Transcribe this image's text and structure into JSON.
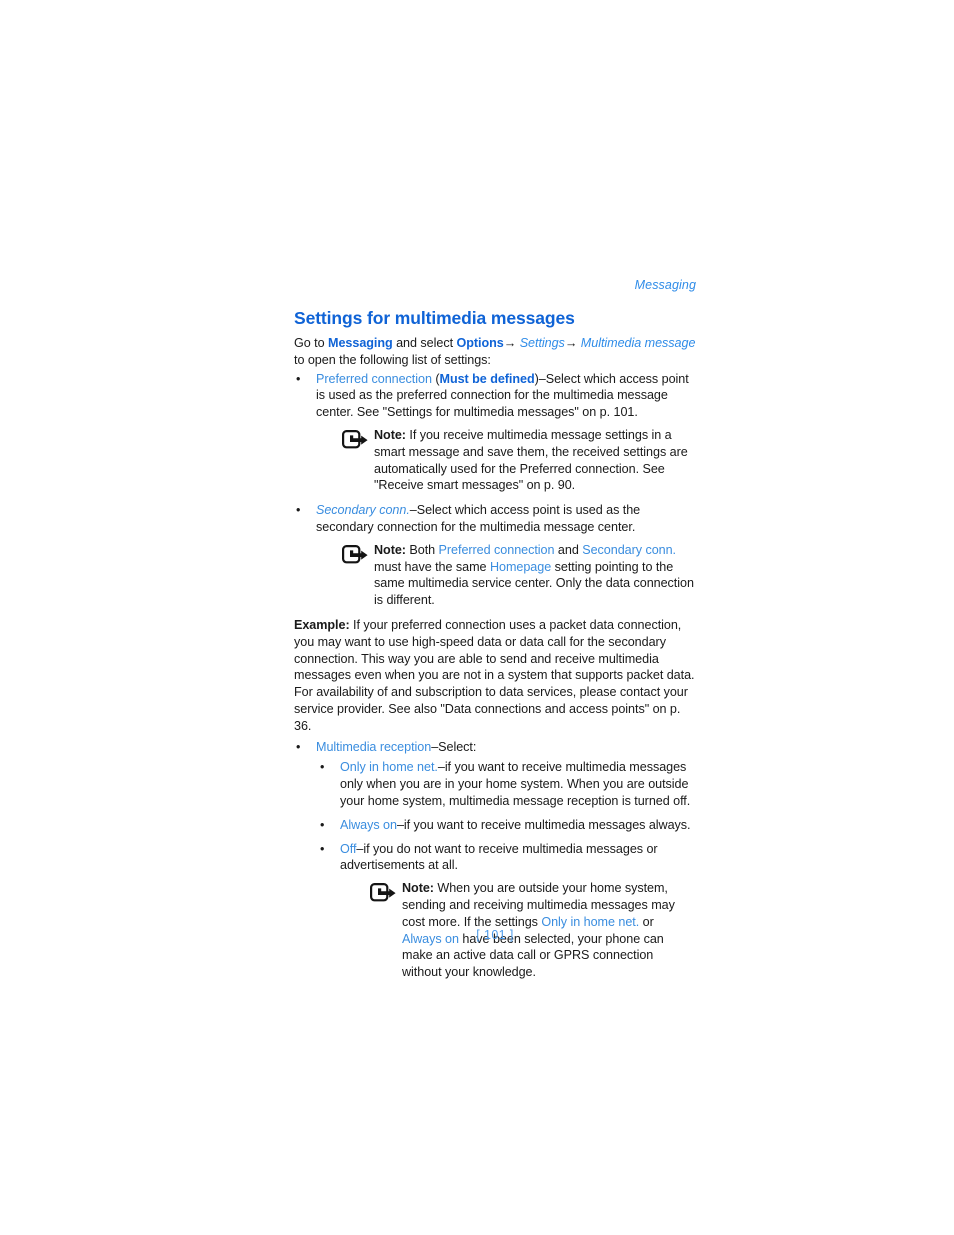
{
  "header": {
    "running_title": "Messaging"
  },
  "page_title": "Settings for multimedia messages",
  "intro": {
    "line_prefix": "Go to ",
    "messaging": "Messaging",
    "and_select": " and select ",
    "options": "Options",
    "arrow1": "→",
    "settings": " Settings",
    "arrow2": "→",
    "multimedia_message": " Multimedia message",
    "line2": "to open the following list of settings:"
  },
  "bullets": {
    "preferred_connection": {
      "term": "Preferred connection",
      "paren_open": " (",
      "must_be_defined": "Must be defined",
      "paren_close": ")",
      "desc": "–Select which access point is used as the preferred connection for the multimedia message center. See \"Settings for multimedia messages\" on p. 101."
    },
    "secondary_conn": {
      "term": "Secondary conn.",
      "desc": "–Select which access point is used as the secondary connection for the multimedia message center."
    },
    "multimedia_reception": {
      "term": "Multimedia reception",
      "desc": "–Select:"
    },
    "sub": [
      {
        "term": "Only in home net.",
        "desc": "–if you want to receive multimedia messages only when you are in your home system. When you are outside your home system, multimedia message reception is turned off."
      },
      {
        "term": "Always on",
        "desc": "–if you want to receive multimedia messages always."
      },
      {
        "term": "Off",
        "desc": "–if you do not want to receive multimedia messages or advertisements at all."
      }
    ]
  },
  "notes": {
    "note1": {
      "label": "Note:",
      "text": " If you receive multimedia message settings in a smart message and save them, the received settings are automatically used for the Preferred connection. See \"Receive smart messages\" on p. 90."
    },
    "note2": {
      "label": "Note:",
      "part1": " Both ",
      "link1": "Preferred connection",
      "part2": " and ",
      "link2": "Secondary conn.",
      "part3": " must have the same ",
      "link3": "Homepage",
      "part4": " setting pointing to the same multimedia service center. Only the data connection is different."
    },
    "note3": {
      "label": "Note:",
      "part1": " When you are outside your home system, sending and receiving multimedia messages may cost more. If the settings ",
      "link1": "Only in home net.",
      "part2": " or ",
      "link2": "Always on",
      "part3": " have been selected, your phone can make an active data call or GPRS connection without your knowledge."
    }
  },
  "example": {
    "label": "Example:",
    "text": " If your preferred connection uses a packet data connection, you may want to use high-speed data or data call for the secondary connection. This way you are able to send and receive multimedia messages even when you are not in a system that supports packet data. For availability of and subscription to data services, please contact your service provider. See also \"Data connections and access points\" on p. 36."
  },
  "page_number": "[ 101 ]",
  "icons": {
    "note_icon": "note-pointer-icon",
    "bullet": "•"
  },
  "colors": {
    "heading_blue": "#0f63d6",
    "link_blue": "#3a8ddf",
    "running_header_blue": "#2f8ce8",
    "page_number_blue": "#4e9bea",
    "body_black": "#1a1a1a"
  }
}
